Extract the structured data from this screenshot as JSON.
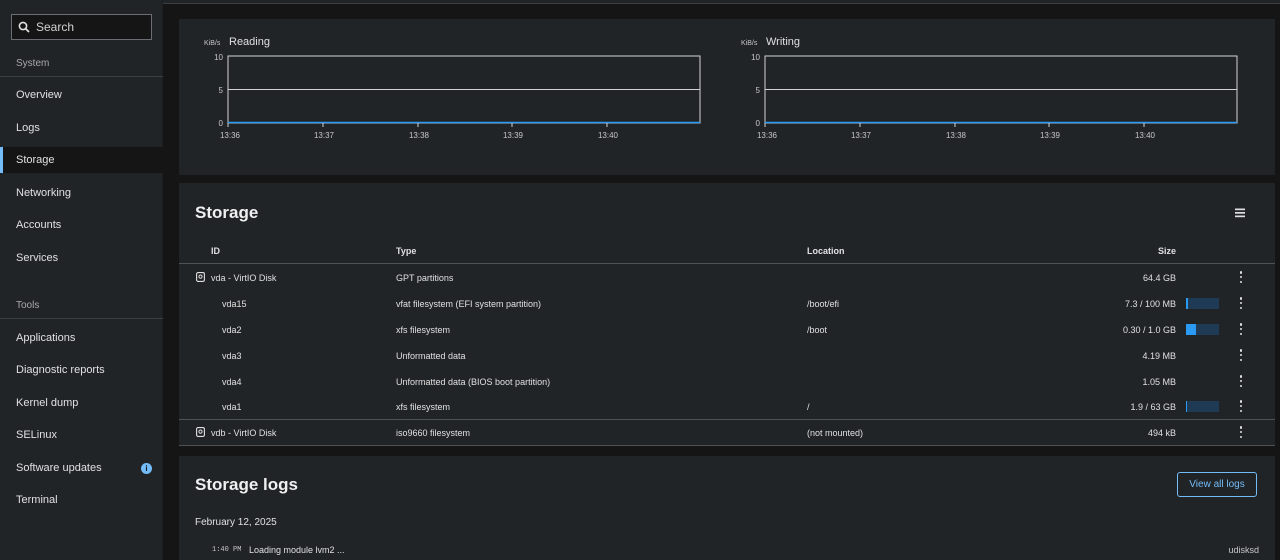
{
  "sidebar": {
    "search_placeholder": "Search",
    "system_label": "System",
    "system_items": [
      {
        "label": "Overview"
      },
      {
        "label": "Logs"
      },
      {
        "label": "Storage",
        "active": true
      },
      {
        "label": "Networking"
      },
      {
        "label": "Accounts"
      },
      {
        "label": "Services"
      }
    ],
    "tools_label": "Tools",
    "tools_items": [
      {
        "label": "Applications"
      },
      {
        "label": "Diagnostic reports"
      },
      {
        "label": "Kernel dump"
      },
      {
        "label": "SELinux"
      },
      {
        "label": "Software updates",
        "badge": "i"
      },
      {
        "label": "Terminal"
      }
    ]
  },
  "charts": {
    "reading": {
      "unit": "KiB/s",
      "title": "Reading"
    },
    "writing": {
      "unit": "KiB/s",
      "title": "Writing"
    },
    "y_ticks": [
      "10",
      "5",
      "0"
    ],
    "x_ticks": [
      "13:36",
      "13:37",
      "13:38",
      "13:39",
      "13:40"
    ]
  },
  "storage": {
    "title": "Storage",
    "columns": {
      "id": "ID",
      "type": "Type",
      "location": "Location",
      "size": "Size"
    },
    "rows": [
      {
        "id": "vda - VirtIO Disk",
        "type": "GPT partitions",
        "location": "",
        "size": "64.4 GB",
        "disk": true
      },
      {
        "id": "vda15",
        "type": "vfat filesystem (EFI system partition)",
        "location": "/boot/efi",
        "size": "7.3 / 100 MB",
        "usage": 0.073
      },
      {
        "id": "vda2",
        "type": "xfs filesystem",
        "location": "/boot",
        "size": "0.30 / 1.0 GB",
        "usage": 0.3
      },
      {
        "id": "vda3",
        "type": "Unformatted data",
        "location": "",
        "size": "4.19 MB"
      },
      {
        "id": "vda4",
        "type": "Unformatted data (BIOS boot partition)",
        "location": "",
        "size": "1.05 MB"
      },
      {
        "id": "vda1",
        "type": "xfs filesystem",
        "location": "/",
        "size": "1.9 / 63 GB",
        "usage": 0.03
      },
      {
        "id": "vdb - VirtIO Disk",
        "type": "iso9660 filesystem",
        "location": "(not mounted)",
        "size": "494 kB",
        "disk": true
      }
    ]
  },
  "logs": {
    "title": "Storage logs",
    "view_all_label": "View all logs",
    "date": "February 12, 2025",
    "entries": [
      {
        "time": "1:40 PM",
        "message": "Loading module lvm2 ...",
        "source": "udisksd"
      }
    ]
  },
  "colors": {
    "accent": "#73bcf7",
    "usage_fill": "#2b9af3",
    "usage_track": "#1f3a55"
  }
}
